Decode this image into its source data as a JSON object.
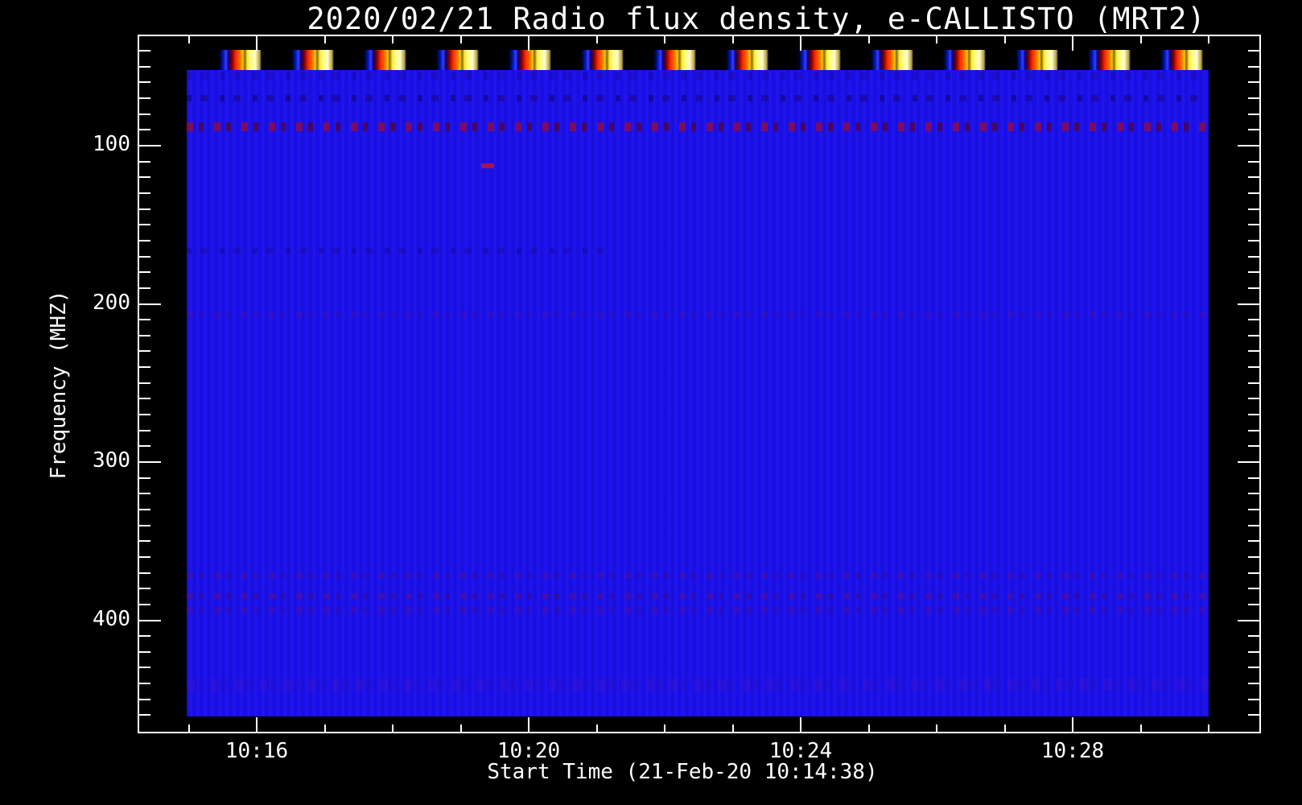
{
  "figure": {
    "title": "2020/02/21  Radio flux density, e-CALLISTO (MRT2)",
    "x_axis": {
      "label": "Start Time (21-Feb-20 10:14:38)",
      "major_tick_labels": [
        "10:16",
        "10:20",
        "10:24",
        "10:28"
      ]
    },
    "y_axis": {
      "label": "Frequency (MHZ)",
      "major_tick_labels": [
        "100",
        "200",
        "300",
        "400"
      ]
    }
  },
  "chart_data": {
    "type": "heatmap",
    "title": "2020/02/21  Radio flux density, e-CALLISTO (MRT2)",
    "xlabel": "Start Time (21-Feb-20 10:14:38)",
    "ylabel": "Frequency (MHZ)",
    "x_tick_labels": [
      "10:16",
      "10:20",
      "10:24",
      "10:28"
    ],
    "x_start_time": "21-Feb-20 10:14:38",
    "x_minor_tick_interval": "1 min",
    "y_tick_values_mhz": [
      100,
      200,
      300,
      400
    ],
    "y_minor_tick_interval_mhz": 10,
    "y_axis_direction": "frequency increases downward",
    "values_summary": "Radio flux density is nearly uniform at a low level (solid blue) over the full band for the whole 10:14:38-10:30 interval; faint darker/reddish interference lanes appear near the 100 MHz row, around 150 MHz, near 380-400 MHz and near the bottom of the band",
    "calibration_bursts": {
      "count": 14,
      "spacing": "~64 s",
      "location": "lowest-frequency channels along the top edge of the spectrogram",
      "color_ramp": [
        "#0018c8",
        "#3340ff",
        "#8c0000",
        "#ff2a00",
        "#ff9100",
        "#ffe63c",
        "#fffdc8"
      ]
    },
    "colormap_base": "#1c10e8"
  },
  "colors": {
    "background": "#000000",
    "axes": "#ffffff",
    "text": "#ffffff",
    "spectrogram_blue": "#1c10e8"
  }
}
